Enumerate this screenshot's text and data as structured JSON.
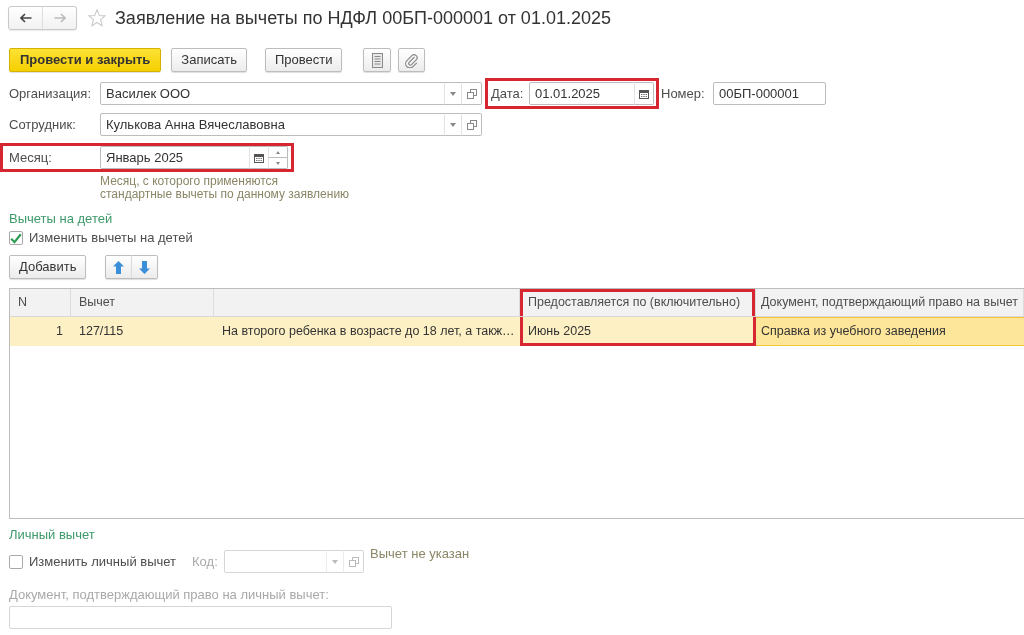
{
  "window": {
    "title": "Заявление на вычеты по НДФЛ 00БП-000001 от 01.01.2025",
    "favorite": false
  },
  "navigation": {
    "back": {
      "disabled": false
    },
    "forward": {
      "disabled": true
    }
  },
  "toolbar": {
    "buttons": [
      {
        "label": "Провести и закрыть",
        "kind": "default"
      },
      {
        "label": "Записать",
        "kind": "normal"
      },
      {
        "label": "Провести",
        "kind": "normal"
      }
    ]
  },
  "header_fields": {
    "organization": {
      "label": "Организация:",
      "value": "Василек ООО"
    },
    "date": {
      "label": "Дата:",
      "value": "01.01.2025",
      "highlighted": true
    },
    "number": {
      "label": "Номер:",
      "value": "00БП-000001"
    },
    "employee": {
      "label": "Сотрудник:",
      "value": "Кулькова Анна Вячеславовна"
    },
    "month": {
      "label": "Месяц:",
      "value": "Январь 2025",
      "highlighted": true,
      "hint_lines": [
        "Месяц, с которого применяются",
        "стандартные вычеты по данному заявлению"
      ]
    }
  },
  "children_deductions": {
    "title": "Вычеты на детей",
    "checkbox": {
      "label": "Изменить вычеты на детей",
      "checked": true
    },
    "add_button": "Добавить",
    "table": {
      "columns": [
        {
          "label": "N",
          "kind": "number",
          "highlighted": false
        },
        {
          "label": "Вычет",
          "kind": "text",
          "highlighted": false
        },
        {
          "kind": "text",
          "highlighted": false
        },
        {
          "label": "Предоставляется по (включительно)",
          "kind": "text",
          "highlighted": true
        },
        {
          "label": "Документ, подтверждающий право на вычет",
          "kind": "text",
          "highlighted": false
        }
      ],
      "rows": [
        {
          "selected": true,
          "cells": [
            {
              "text": "1",
              "focused": false
            },
            {
              "text": "127/115",
              "focused": false
            },
            {
              "text": "На второго ребенка в возрасте до 18 лет, а такж…",
              "focused": false
            },
            {
              "text": "Июнь 2025",
              "focused": false
            },
            {
              "text": "Справка из учебного заведения",
              "focused": true
            }
          ]
        }
      ]
    }
  },
  "personal_deduction": {
    "title": "Личный вычет",
    "checkbox": {
      "label": "Изменить личный вычет",
      "checked": false
    },
    "code": {
      "label": "Код:",
      "disabled": true
    },
    "status": "Вычет не указан",
    "document": {
      "label": "Документ, подтверждающий право на личный вычет:",
      "disabled": true
    }
  }
}
